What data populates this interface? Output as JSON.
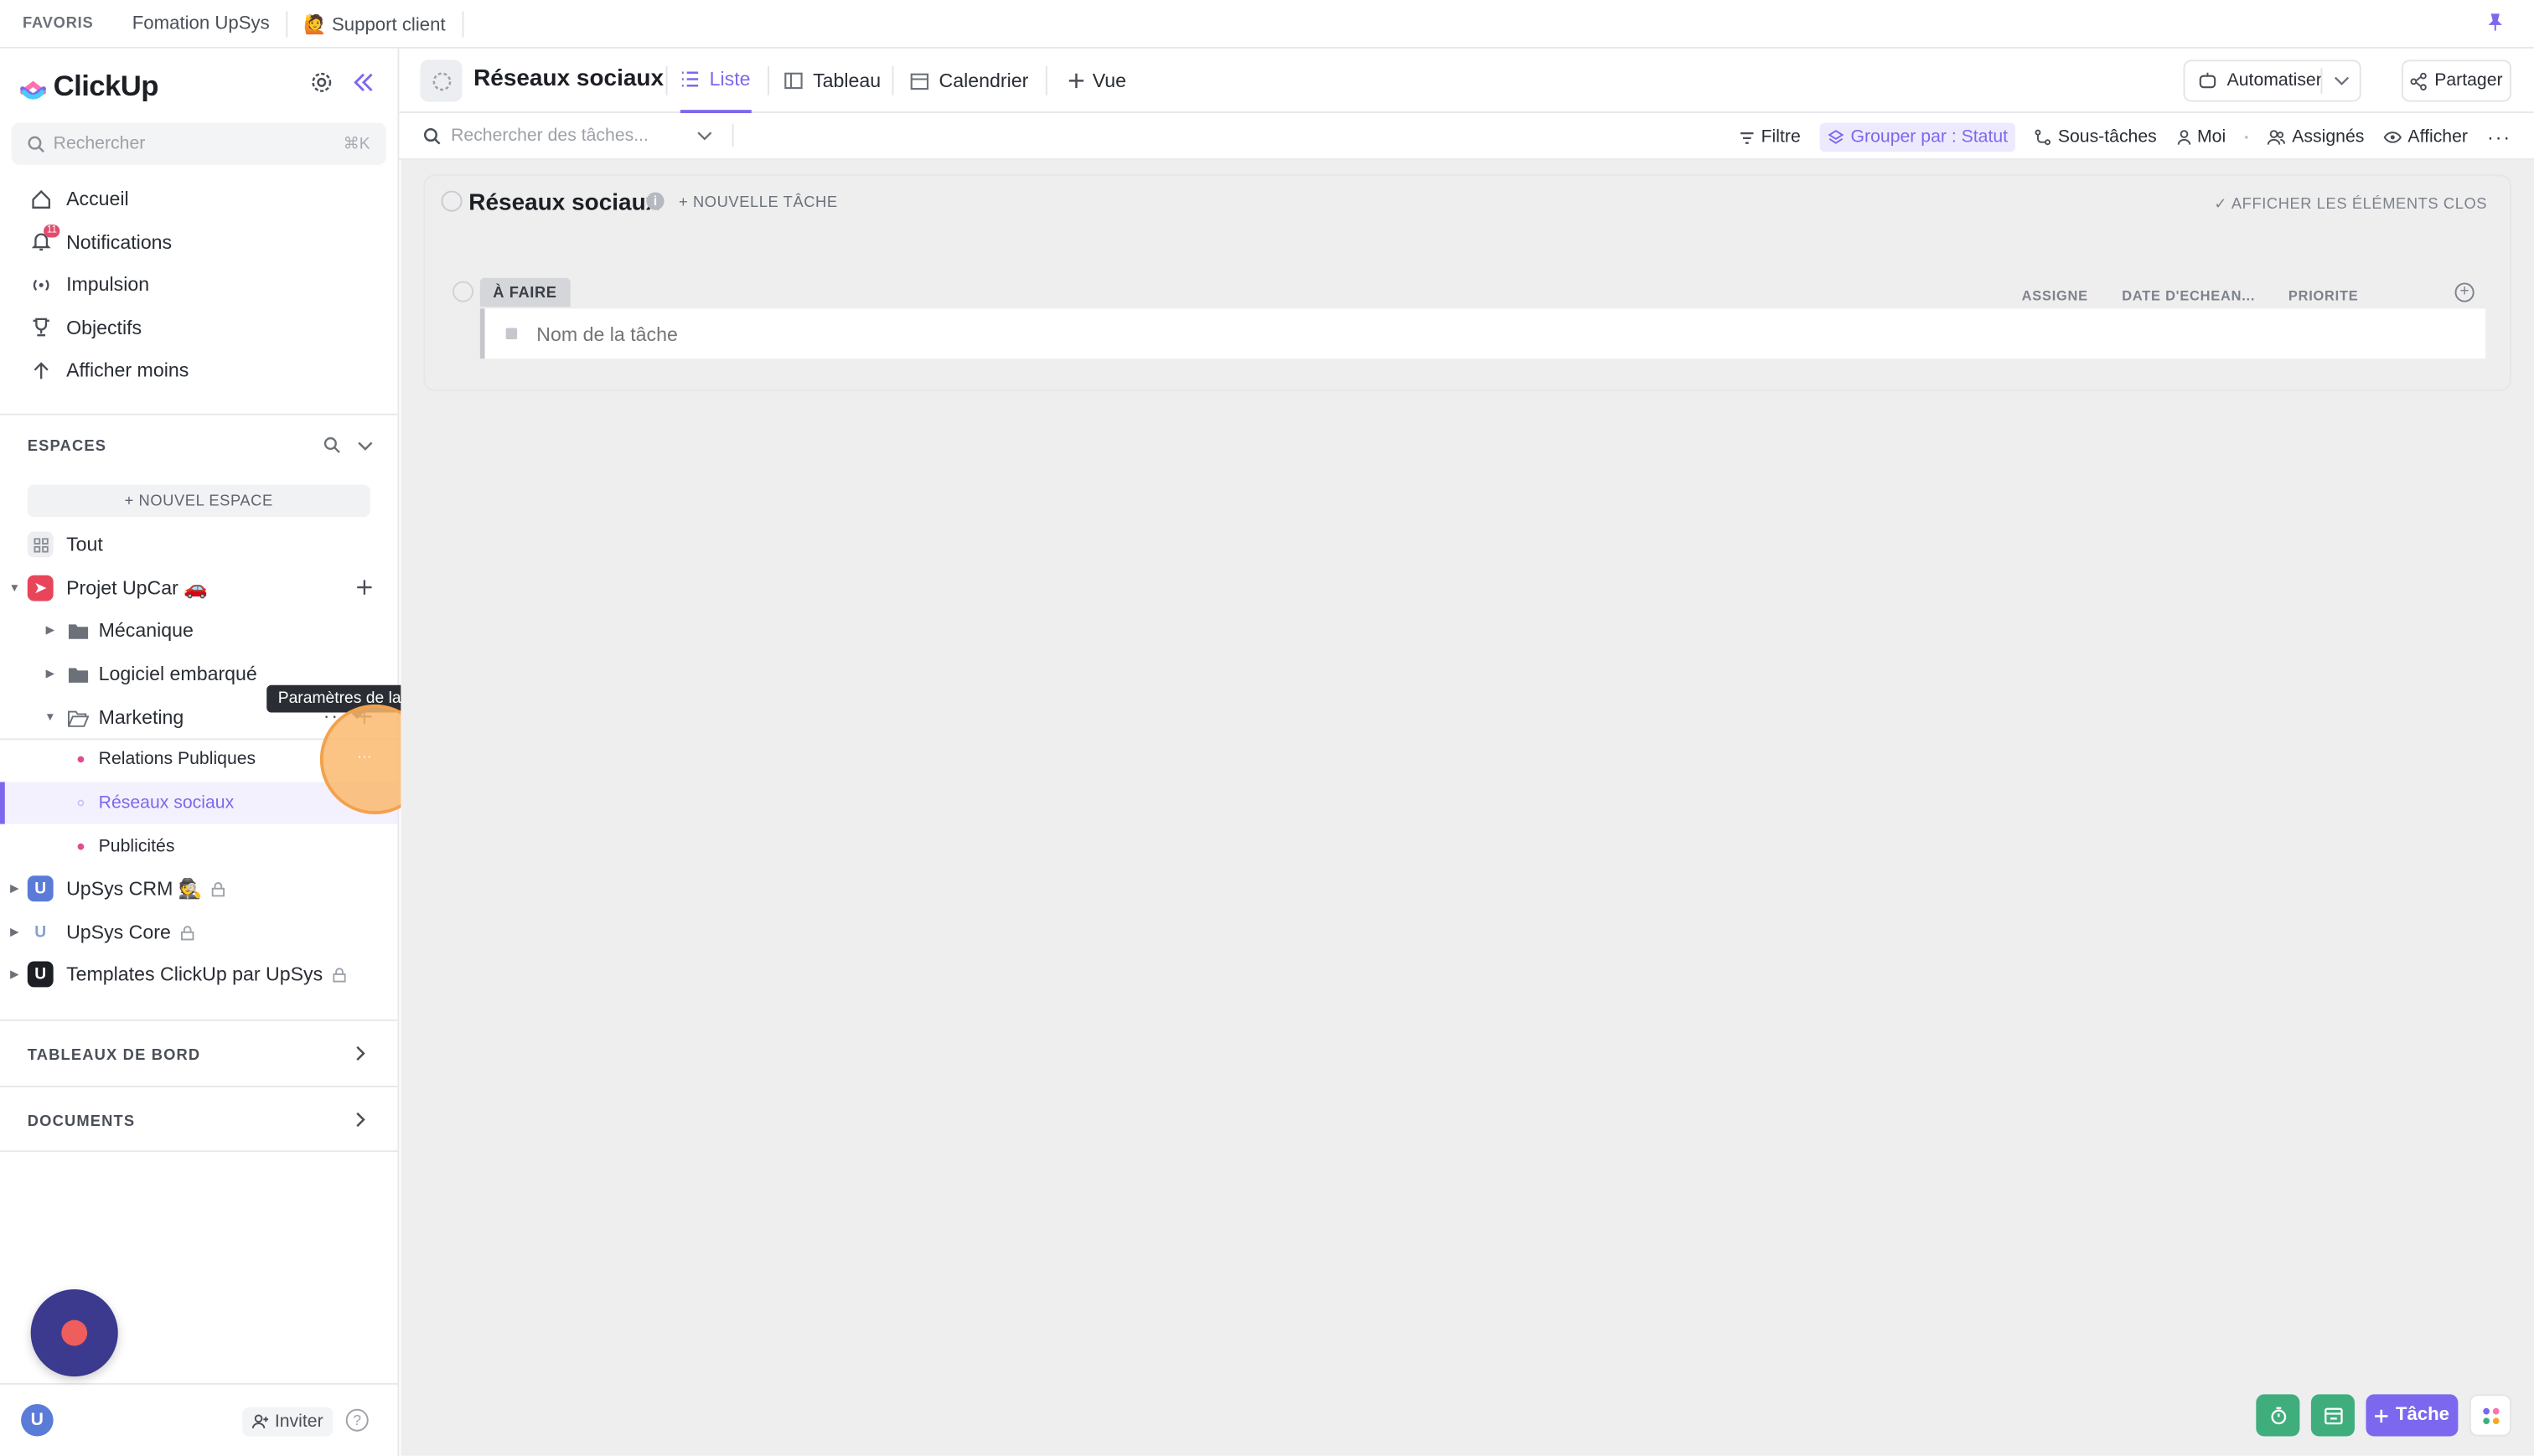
{
  "favorites": {
    "title": "FAVORIS",
    "items": [
      "Fomation UpSys",
      "🙋 Support client"
    ]
  },
  "app": {
    "name": "ClickUp",
    "accent": "#7b68ee"
  },
  "sidebar": {
    "search_placeholder": "Rechercher",
    "search_shortcut": "⌘K",
    "nav": [
      {
        "label": "Accueil",
        "icon": "home-icon"
      },
      {
        "label": "Notifications",
        "icon": "bell-icon",
        "badge": "11"
      },
      {
        "label": "Impulsion",
        "icon": "pulse-icon"
      },
      {
        "label": "Objectifs",
        "icon": "trophy-icon"
      },
      {
        "label": "Afficher moins",
        "icon": "arrow-up-icon"
      }
    ],
    "spaces_title": "ESPACES",
    "new_space": "+ NOUVEL ESPACE",
    "all": "Tout",
    "projet": "Projet UpCar 🚗",
    "folders": {
      "mecanique": "Mécanique",
      "logiciel": "Logiciel embarqué",
      "marketing": "Marketing"
    },
    "lists": {
      "rp": "Relations Publiques",
      "reseaux": "Réseaux sociaux",
      "pub": "Publicités"
    },
    "other_spaces": {
      "crm": "UpSys CRM 🕵️",
      "core": "UpSys Core",
      "templates": "Templates ClickUp par UpSys"
    },
    "dashboards": "TABLEAUX DE BORD",
    "documents": "DOCUMENTS",
    "tooltip": "Paramètres de la liste",
    "invite": "Inviter",
    "help": "?"
  },
  "header": {
    "title": "Réseaux sociaux",
    "tabs": [
      "Liste",
      "Tableau",
      "Calendrier"
    ],
    "add_view": "Vue",
    "automate": "Automatiser",
    "share": "Partager"
  },
  "toolbar": {
    "search_placeholder": "Rechercher des tâches...",
    "filter": "Filtre",
    "group_by": "Grouper par : Statut",
    "subtasks": "Sous-tâches",
    "me": "Moi",
    "assignees": "Assignés",
    "show": "Afficher"
  },
  "list": {
    "title": "Réseaux sociaux",
    "new_task": "+ NOUVELLE TÂCHE",
    "show_closed": "AFFICHER LES ÉLÉMENTS CLOS",
    "status": "À FAIRE",
    "columns": [
      "ASSIGNE",
      "DATE D'ECHEAN...",
      "PRIORITE"
    ],
    "task_placeholder": "Nom de la tâche"
  },
  "fab": {
    "task": "Tâche"
  }
}
